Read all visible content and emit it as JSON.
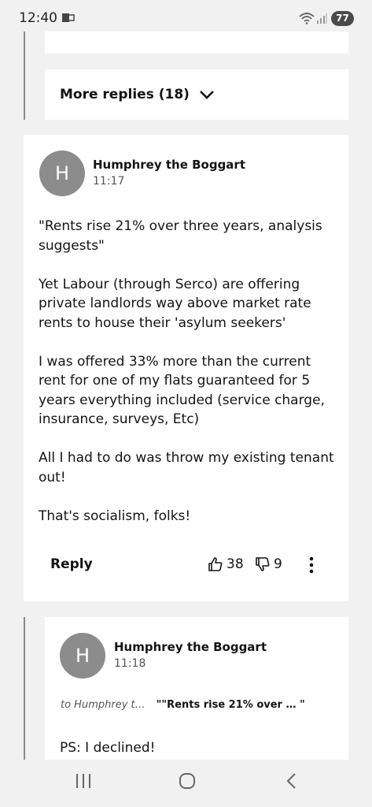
{
  "status": {
    "time": "12:40",
    "battery": "77"
  },
  "more_replies": {
    "label": "More replies (18)"
  },
  "comment": {
    "avatar": "H",
    "author": "Humphrey the Boggart",
    "time": "11:17",
    "paragraphs": [
      "\"Rents rise 21% over three years, analysis suggests\"",
      "Yet Labour (through Serco) are offering private landlords way above market rate rents to house their 'asylum seekers'",
      "I was offered 33% more than the current rent for one of my flats guaranteed for 5 years everything included (service charge, insurance, surveys, Etc)",
      "All I had to do was throw my existing tenant out!",
      "That's socialism, folks!"
    ],
    "reply_label": "Reply",
    "likes": "38",
    "dislikes": "9"
  },
  "reply": {
    "avatar": "H",
    "author": "Humphrey the Boggart",
    "time": "11:18",
    "to": "to Humphrey t…",
    "quote": "\"\"Rents rise 21% over … \"",
    "text": "PS: I declined!"
  },
  "icons": {
    "notification": "notification-icon",
    "wifi": "wifi-icon",
    "signal": "signal-icon",
    "chevron": "chevron-down-icon",
    "thumbs_up": "thumbs-up-icon",
    "thumbs_down": "thumbs-down-icon",
    "more": "more-vertical-icon",
    "nav_recents": "recents-icon",
    "nav_home": "home-icon",
    "nav_back": "back-icon"
  },
  "colors": {
    "background": "#f1f1f1",
    "card": "#ffffff",
    "avatar": "#8c8c8c",
    "text": "#141414"
  }
}
